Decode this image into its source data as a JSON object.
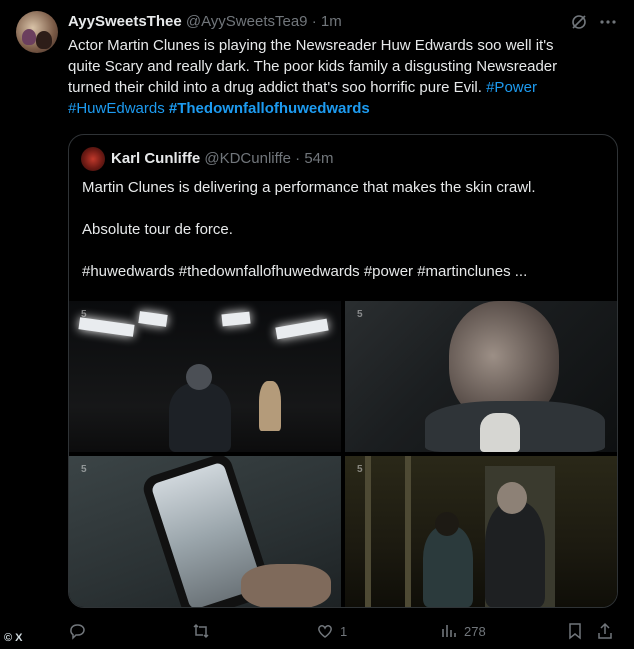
{
  "post": {
    "display_name": "AyySweetsThee",
    "handle_time": "@AyySweetsTea9 · 1m",
    "text_lines": [
      "Actor Martin Clunes is playing the Newsreader Huw Edwards soo well it's",
      "quite Scary and really dark. The poor kids family a disgusting Newsreader",
      "turned their child into a drug addict that's soo horrific pure Evil."
    ],
    "hashtag_power": "#Power",
    "hashtag_huw": "#HuwEdwards",
    "hashtag_downfall": "#Thedownfallofhuwedwards"
  },
  "quote": {
    "display_name": "Karl Cunliffe",
    "handle_time": "@KDCunliffe · 54m",
    "line1": "Martin Clunes is delivering a performance that makes the skin crawl.",
    "line2": "Absolute tour de force.",
    "line3": "#huwedwards #thedownfallofhuwedwards #power #martinclunes  ...",
    "watermark": "5"
  },
  "actions": {
    "likes": "1",
    "views": "278"
  },
  "source_badge": "© X"
}
